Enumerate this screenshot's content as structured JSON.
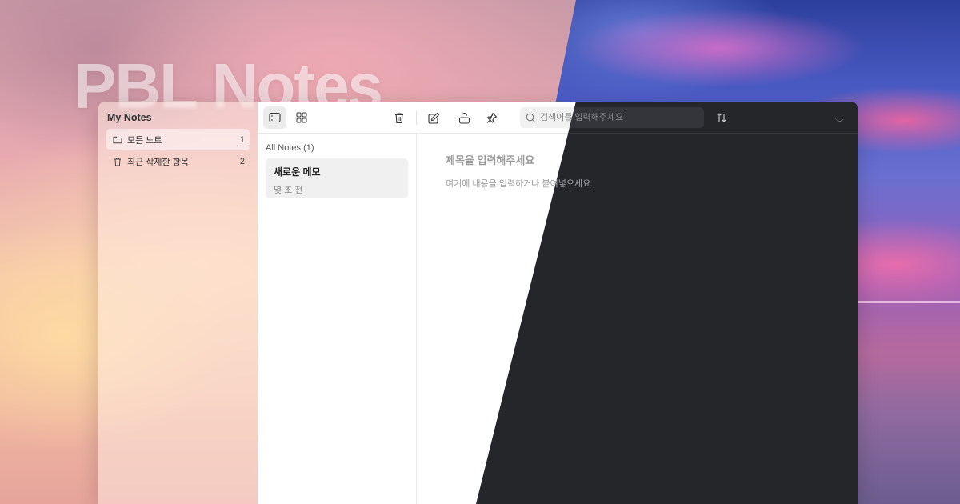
{
  "brand": {
    "title": "PBL Notes"
  },
  "sidebar": {
    "title": "My Notes",
    "folders": [
      {
        "label": "모든 노트",
        "count": "1",
        "icon": "folder-icon",
        "active": true
      },
      {
        "label": "최근 삭제한 항목",
        "count": "2",
        "icon": "trash-icon",
        "active": false
      }
    ]
  },
  "toolbar": {
    "search_placeholder": "검색어를 입력해주세요",
    "buttons": [
      "list-view-icon",
      "grid-view-icon",
      "trash-icon",
      "compose-icon",
      "unlock-icon",
      "pin-icon",
      "sort-icon",
      "moon-icon"
    ]
  },
  "list": {
    "header": "All Notes (1)",
    "notes": [
      {
        "title": "새로운 메모",
        "time": "몇 초 전"
      }
    ]
  },
  "editor": {
    "title_placeholder": "제목을 입력해주세요",
    "body_placeholder": "여기에 내용을 입력하거나 붙여넣으세요."
  },
  "colors": {
    "light_bg": "#ffffff",
    "dark_bg": "#25262a",
    "accent_active": "#ececec"
  }
}
